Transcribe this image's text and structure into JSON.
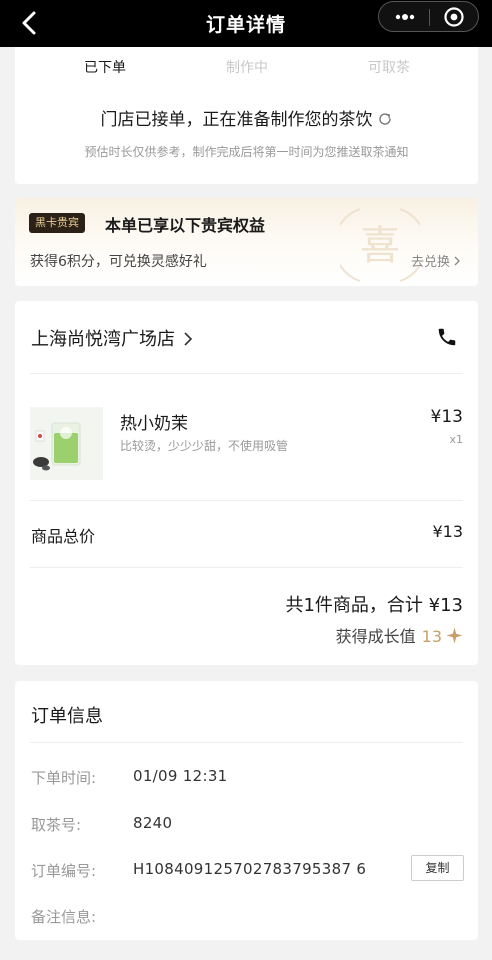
{
  "nav": {
    "title": "订单详情"
  },
  "status": {
    "steps": [
      "已下单",
      "制作中",
      "可取茶"
    ],
    "message": "门店已接单，正在准备制作您的茶饮",
    "note": "预估时长仅供参考，制作完成后将第一时间为您推送取茶通知"
  },
  "vip": {
    "badge": "黑卡贵宾",
    "title": "本单已享以下贵宾权益",
    "benefit": "获得6积分，可兑换灵感好礼",
    "link": "去兑换",
    "seal_char": "喜"
  },
  "order": {
    "store_name": "上海尚悦湾广场店",
    "item": {
      "name": "热小奶茉",
      "options": "比较烫，少少少甜，不使用吸管",
      "price": "¥13",
      "qty": "x1"
    },
    "subtotal_label": "商品总价",
    "subtotal_value": "¥13",
    "total_text": "共1件商品，合计 ¥13",
    "growth_label": "获得成长值",
    "growth_value": "13"
  },
  "info": {
    "title": "订单信息",
    "rows": [
      {
        "label": "下单时间:",
        "value": "01/09 12:31"
      },
      {
        "label": "取茶号:",
        "value": "8240"
      },
      {
        "label": "订单编号:",
        "value": "H108409125702783795387 6"
      },
      {
        "label": "备注信息:",
        "value": ""
      }
    ],
    "copy_label": "复制"
  },
  "colors": {
    "accent_gold": "#c9a06a",
    "badge_bg": "#2b2117",
    "badge_text": "#e7cb94",
    "nav_bg": "#000000"
  },
  "icons": [
    "back-icon",
    "more-icon",
    "target-icon",
    "refresh-icon",
    "chevron-right-icon",
    "phone-icon",
    "star-icon"
  ]
}
